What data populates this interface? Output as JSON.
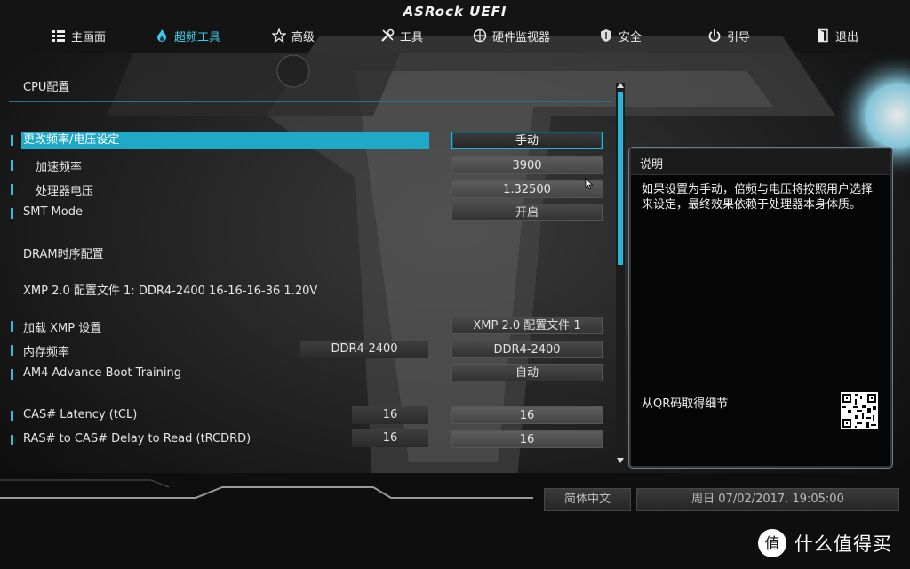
{
  "brand": "ASRock UEFI",
  "nav": [
    {
      "label": "主画面",
      "icon": "list-icon"
    },
    {
      "label": "超频工具",
      "icon": "flame-icon"
    },
    {
      "label": "高级",
      "icon": "star-icon"
    },
    {
      "label": "工具",
      "icon": "tools-icon"
    },
    {
      "label": "硬件监视器",
      "icon": "crosshair-icon"
    },
    {
      "label": "安全",
      "icon": "shield-icon"
    },
    {
      "label": "引导",
      "icon": "power-icon"
    },
    {
      "label": "退出",
      "icon": "exit-door-icon"
    }
  ],
  "active_tab": "超频工具",
  "sections": {
    "cpu": "CPU配置",
    "dram": "DRAM时序配置",
    "xmp_info": "XMP 2.0 配置文件 1: DDR4-2400 16-16-16-36 1.20V"
  },
  "rows": [
    {
      "label": "更改频率/电压设定",
      "value": "手动"
    },
    {
      "label": "加速频率",
      "value": "3900"
    },
    {
      "label": "处理器电压",
      "value": "1.32500"
    },
    {
      "label": "SMT Mode",
      "value": "开启"
    },
    {
      "label": "加载 XMP 设置",
      "value": "XMP 2.0 配置文件 1"
    },
    {
      "label": "内存频率",
      "current": "DDR4-2400",
      "value": "DDR4-2400"
    },
    {
      "label": "AM4 Advance Boot Training",
      "value": "自动"
    },
    {
      "label": "CAS# Latency (tCL)",
      "current": "16",
      "value": "16"
    },
    {
      "label": "RAS# to CAS# Delay to Read  (tRCDRD)",
      "current": "16",
      "value": "16"
    }
  ],
  "help": {
    "title": "说明",
    "text": "如果设置为手动，倍频与电压将按照用户选择来设定，最终效果依赖于处理器本身体质。",
    "qr_label": "从QR码取得细节"
  },
  "footer": {
    "language": "简体中文",
    "datetime": "周日 07/02/2017. 19:05:00"
  },
  "watermark": {
    "text": "什么值得买",
    "badge": "值"
  },
  "colors": {
    "accent": "#1fa9c9",
    "background": "#0b0c0d"
  }
}
